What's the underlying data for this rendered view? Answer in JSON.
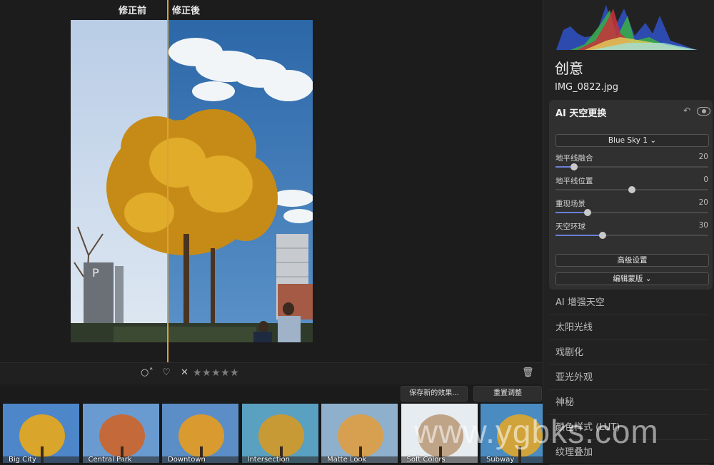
{
  "compare": {
    "before": "修正前",
    "after": "修正後"
  },
  "toolbar": {
    "flag_icon": "circle-dropdown",
    "heart_icon": "heart",
    "reject_icon": "x",
    "stars": 5,
    "trash_icon": "trash"
  },
  "actions": {
    "save": "保存新的效果...",
    "reset": "重置调整"
  },
  "presets": [
    "Big City",
    "Central Park",
    "Downtown",
    "Intersection",
    "Matte Look",
    "Soft Colors",
    "Subway"
  ],
  "panel": {
    "title": "创意",
    "filename": "IMG_0822.jpg",
    "ai_sky": {
      "title": "AI 天空更换",
      "sky_select": "Blue Sky 1 ⌄",
      "sliders": [
        {
          "label": "地平线融合",
          "value": "20",
          "level": 0.12
        },
        {
          "label": "地平线位置",
          "value": "0",
          "level": 0.5
        },
        {
          "label": "重现场景",
          "value": "20",
          "level": 0.21
        },
        {
          "label": "天空环球",
          "value": "30",
          "level": 0.31
        }
      ],
      "advanced": "高级设置",
      "edit_mask": "编辑蒙版 ⌄"
    },
    "sections": [
      "AI 增强天空",
      "太阳光线",
      "戏剧化",
      "亚光外观",
      "神秘",
      "颜色样式 (LUT)",
      "纹理叠加"
    ]
  },
  "watermark": "www.ygbks.com",
  "colors": {
    "accent_line": "#d9a23a",
    "slider_fill": "#6b7fd7",
    "panel_bg": "#222222"
  }
}
